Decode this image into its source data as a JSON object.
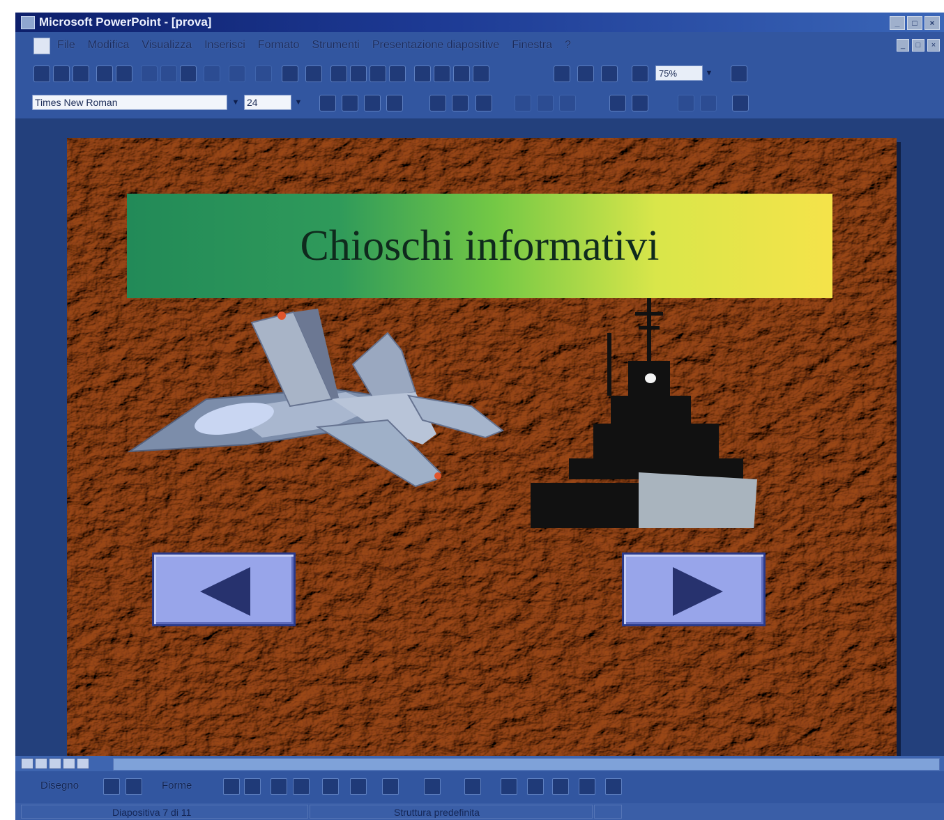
{
  "window": {
    "title": "Microsoft PowerPoint - [prova]",
    "buttons": [
      "_",
      "□",
      "×"
    ],
    "mdi_buttons": [
      "_",
      "□",
      "×"
    ]
  },
  "menubar": {
    "items": [
      "File",
      "Modifica",
      "Visualizza",
      "Inserisci",
      "Formato",
      "Strumenti",
      "Presentazione diapositive",
      "Finestra",
      "?"
    ]
  },
  "toolbar": {
    "zoom_value": "75%",
    "font_name": "Times New Roman",
    "font_size": "24"
  },
  "slide": {
    "title": "Chioschi informativi",
    "images": [
      "jet-fighter-icon",
      "warship-icon"
    ],
    "buttons": [
      "prev-arrow-icon",
      "next-arrow-icon"
    ]
  },
  "drawing_toolbar": {
    "disegno_label": "Disegno",
    "forme_label": "Forme"
  },
  "statusbar": {
    "slide_info": "Diapositiva 7 di 11",
    "template": "Struttura predefinita"
  },
  "colors": {
    "window_bg": "#24407e",
    "title_gradient_start": "#228a58",
    "title_gradient_end": "#f5e34a",
    "nav_button": "#98a5ea",
    "nav_arrow": "#27326e"
  }
}
